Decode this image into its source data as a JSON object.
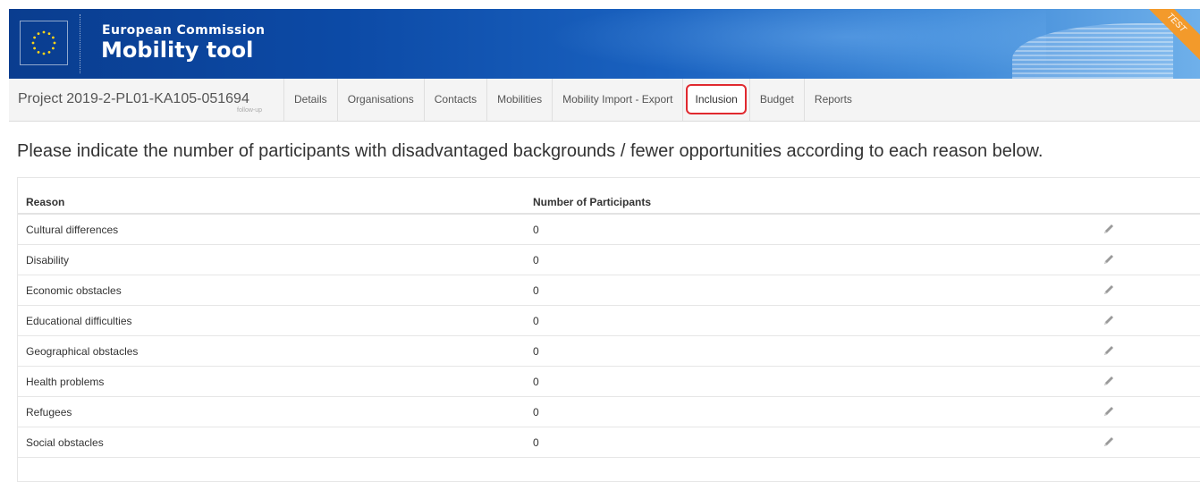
{
  "banner": {
    "org": "European Commission",
    "app": "Mobility tool",
    "env_badge": "TEST"
  },
  "nav": {
    "project_label": "Project 2019-2-PL01-KA105-051694",
    "project_sub": "follow-up",
    "tabs": [
      "Details",
      "Organisations",
      "Contacts",
      "Mobilities",
      "Mobility Import - Export",
      "Inclusion",
      "Budget",
      "Reports"
    ],
    "active_tab": "Inclusion"
  },
  "main": {
    "heading": "Please indicate the number of participants with disadvantaged backgrounds / fewer opportunities according to each reason below.",
    "columns": {
      "reason": "Reason",
      "participants": "Number of Participants"
    },
    "rows": [
      {
        "reason": "Cultural differences",
        "count": "0"
      },
      {
        "reason": "Disability",
        "count": "0"
      },
      {
        "reason": "Economic obstacles",
        "count": "0"
      },
      {
        "reason": "Educational difficulties",
        "count": "0"
      },
      {
        "reason": "Geographical obstacles",
        "count": "0"
      },
      {
        "reason": "Health problems",
        "count": "0"
      },
      {
        "reason": "Refugees",
        "count": "0"
      },
      {
        "reason": "Social obstacles",
        "count": "0"
      }
    ]
  },
  "icons": {
    "row_action": "pencil-icon",
    "logo": "eu-flag-icon"
  },
  "colors": {
    "banner": "#0c4aa6",
    "active_outline": "#e0292f",
    "test_badge": "#f39a2b"
  }
}
